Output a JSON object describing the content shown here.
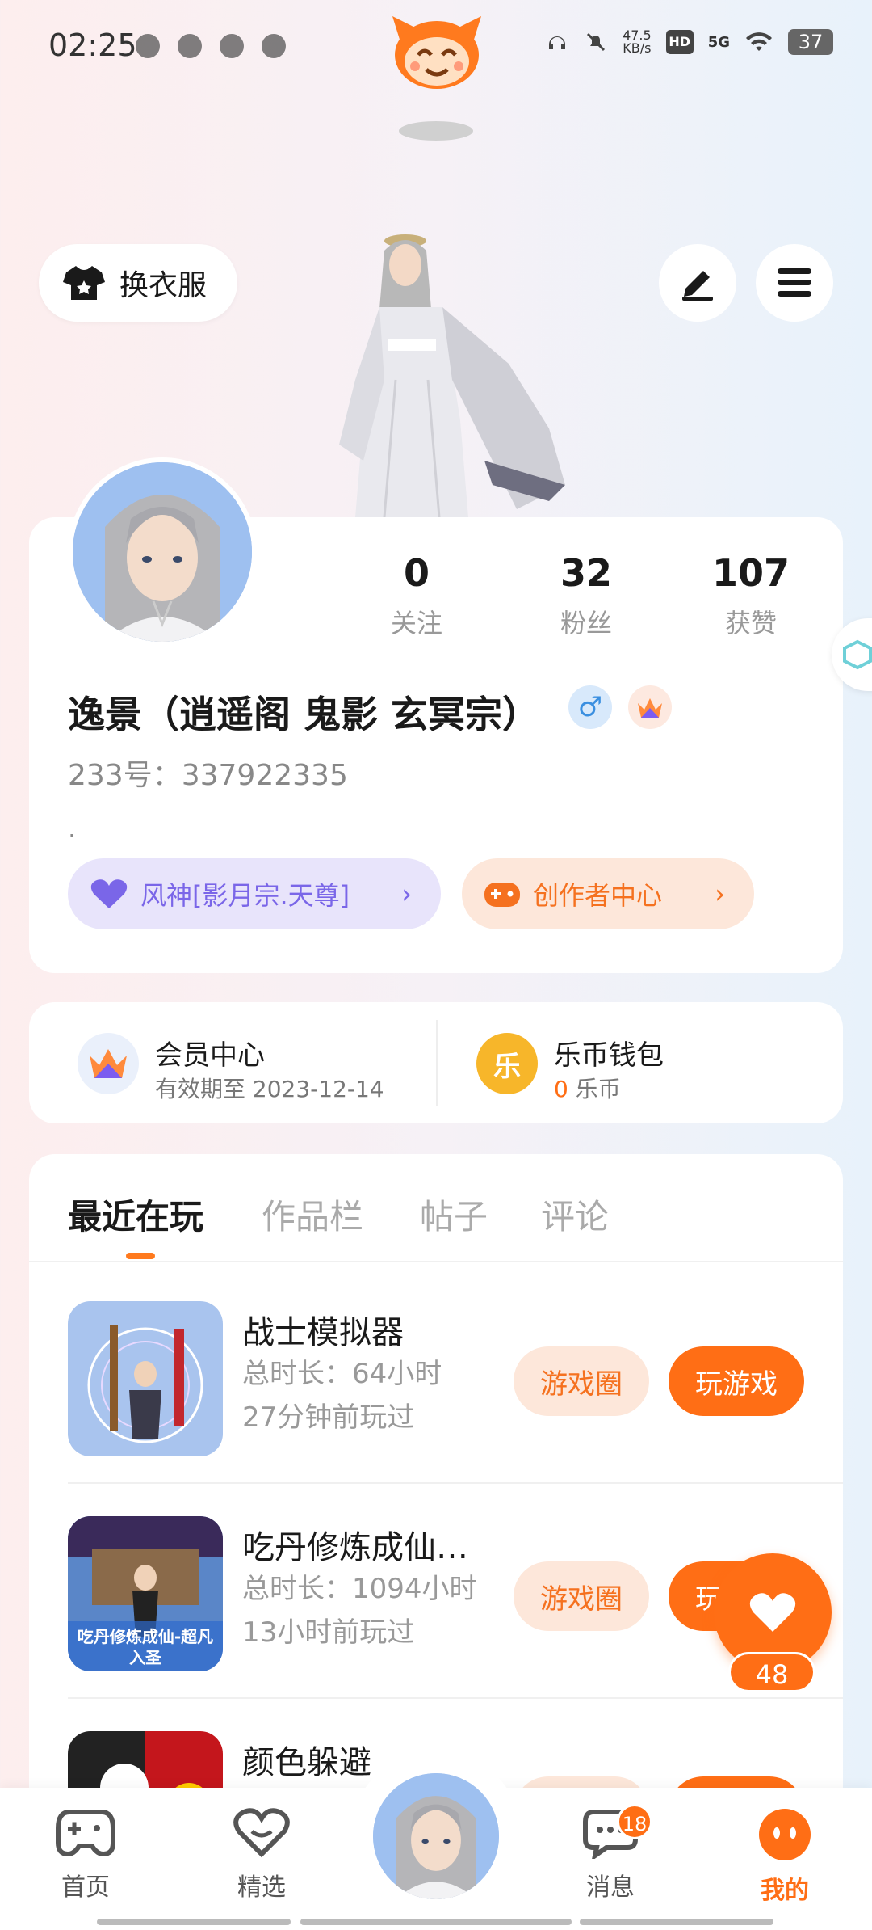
{
  "status_bar": {
    "time": "02:25",
    "net_speed": "47.5",
    "net_unit": "KB/s",
    "hd": "HD",
    "network": "5G",
    "battery": "37"
  },
  "top": {
    "outfit_label": "换衣服"
  },
  "profile": {
    "stats": [
      {
        "value": "0",
        "label": "关注"
      },
      {
        "value": "32",
        "label": "粉丝"
      },
      {
        "value": "107",
        "label": "获赞"
      }
    ],
    "username": "逸景（逍遥阁 鬼影 玄冥宗）",
    "gender_symbol": "♂",
    "uid": "233号：337922335",
    "bio": ".",
    "sect_pill": "风神[影月宗.天尊]",
    "creator_pill": "创作者中心"
  },
  "member": {
    "vip_title": "会员中心",
    "vip_sub": "有效期至 2023-12-14",
    "wallet_title": "乐币钱包",
    "wallet_coin_char": "乐",
    "wallet_amount": "0",
    "wallet_unit": "乐币"
  },
  "tabs": [
    "最近在玩",
    "作品栏",
    "帖子",
    "评论"
  ],
  "games": [
    {
      "name": "战士模拟器",
      "duration": "总时长：64小时",
      "last_played": "27分钟前玩过",
      "circle_label": "游戏圈",
      "play_label": "玩游戏",
      "thumb_text": ""
    },
    {
      "name": "吃丹修炼成仙…",
      "duration": "总时长：1094小时",
      "last_played": "13小时前玩过",
      "circle_label": "游戏圈",
      "play_label": "玩游戏",
      "thumb_text": "吃丹修炼成仙-超凡入圣"
    },
    {
      "name": "颜色躲避",
      "duration": "",
      "last_played": "",
      "circle_label": "",
      "play_label": "",
      "thumb_text": ""
    }
  ],
  "fab": {
    "count": "48"
  },
  "nav": {
    "items": [
      "首页",
      "精选",
      "消息",
      "我的"
    ],
    "message_badge": "18"
  },
  "colors": {
    "accent": "#ff6e15",
    "sect": "#7a66e8"
  }
}
